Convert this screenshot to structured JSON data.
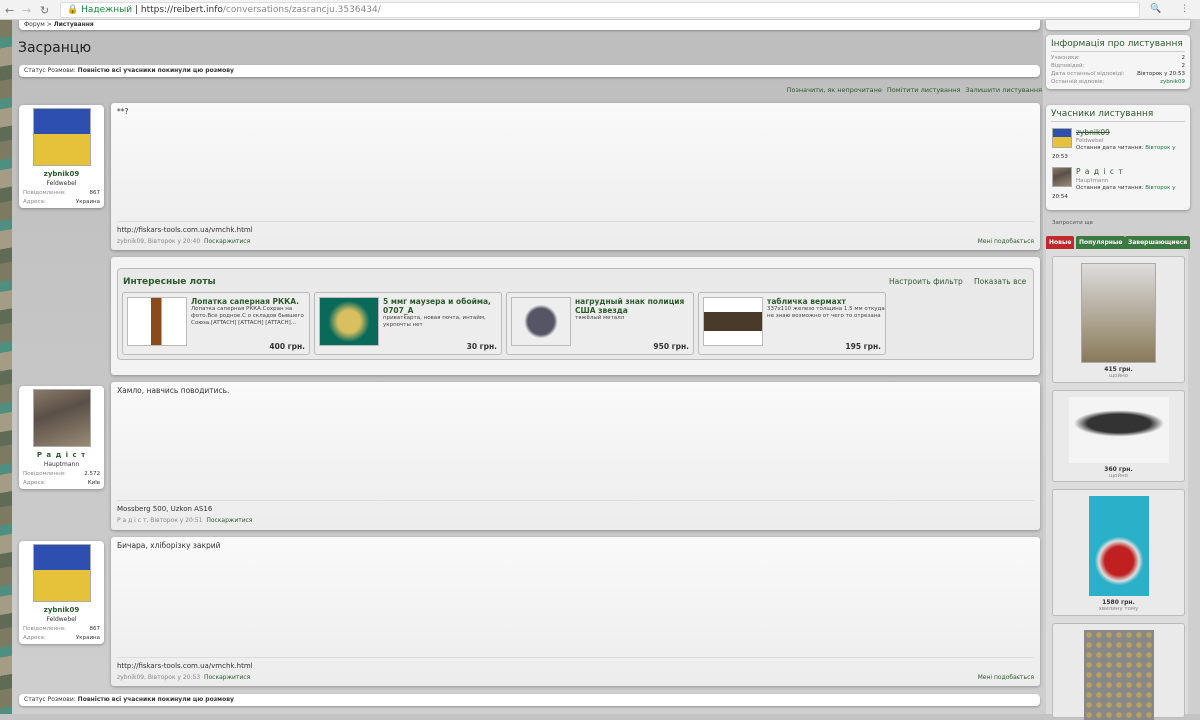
{
  "browser": {
    "secure_label": "Надежный",
    "url_host": "https://reibert.info",
    "url_path": "/conversations/zasrancju.3536434/"
  },
  "breadcrumb": {
    "home": "Форум",
    "sep": ">",
    "current": "Листування"
  },
  "page_title": "Засранцю",
  "status": {
    "label": "Статус Розмови:",
    "value": "Повністю всі учасники покинули цю розмову"
  },
  "actions": [
    "Позначити, як непрочитане",
    "Помітити листування",
    "Залишити листування"
  ],
  "user_labels": {
    "messages": "Повідомлення:",
    "address": "Адреса:"
  },
  "posts": [
    {
      "user": "zybnik09",
      "rank": "Feldwebel",
      "messages": "867",
      "address": "Украина",
      "text": "**?",
      "signature": "http://fiskars-tools.com.ua/vmchk.html",
      "meta": "zybnik09, Вівторок у 20:40",
      "report": "Поскаржитися",
      "like": "Мені подобається"
    },
    {
      "user": "Р а д і с т",
      "rank": "Hauptmann",
      "messages": "2.572",
      "address": "Київ",
      "text": "Хамло, навчись поводитись.",
      "signature": "Mossberg 500, Uzkon AS16",
      "meta": "Р а д і с т, Вівторок у 20:51",
      "report": "Поскаржитися"
    },
    {
      "user": "zybnik09",
      "rank": "Feldwebel",
      "messages": "867",
      "address": "Украина",
      "text": "Бичара, хліборізку закрий",
      "signature": "http://fiskars-tools.com.ua/vmchk.html",
      "meta": "zybnik09, Вівторок у 20:53",
      "report": "Поскаржитися",
      "like": "Мені подобається"
    }
  ],
  "lots": {
    "title": "Интересные лоты",
    "filter": "Настроить фильтр",
    "show_all": "Показать все",
    "items": [
      {
        "title": "Лопатка саперная РККА.",
        "desc": "Лопатка саперная РККА.Сохран на фото.Все родное.С о складов бывшего Союза.[ATTACH] [ATTACH] [ATTACH]...",
        "price": "400 грн."
      },
      {
        "title": "5 ммг маузера и обойма, 0707_A",
        "desc": "приватkарта, новая почта, интайм, укрпочты нет",
        "price": "30 грн."
      },
      {
        "title": "нагрудный знак полиция США звезда",
        "desc": "тяжёлый металл",
        "price": "950 грн."
      },
      {
        "title": "табличка вермахт",
        "desc": "337x110 железо толщина 1.5 мм откуда не знаю возможно от чего то отрезана",
        "price": "195 грн."
      }
    ]
  },
  "sidebar": {
    "info": {
      "title": "Інформація про листування",
      "rows": [
        {
          "k": "Учасники:",
          "v": "2"
        },
        {
          "k": "Відповідей:",
          "v": "2"
        },
        {
          "k": "Дата останньої відповіді:",
          "v": "Вівторок у 20:53"
        },
        {
          "k": "Останній відповів:",
          "v": "zybnik09"
        }
      ]
    },
    "participants": {
      "title": "Учасники листування",
      "read_label": "Остання дата читання:",
      "list": [
        {
          "name": "zybnik09",
          "rank": "Feldwebel",
          "date": "Вівторок у",
          "time": "20:53"
        },
        {
          "name": "Р а д і с т",
          "rank": "Hauptmann",
          "date": "Вівторок у",
          "time": "20:54"
        }
      ]
    },
    "invite": "Запросити ще",
    "tabs": [
      "Новые",
      "Популярные",
      "Завершающиеся"
    ],
    "items": [
      {
        "price": "415 грн.",
        "status": "щойно"
      },
      {
        "price": "360 грн.",
        "status": "щойно"
      },
      {
        "price": "1580 грн.",
        "status": "хвилину тому"
      }
    ]
  },
  "colors": {
    "accent": "#2d5a2d",
    "tab_new": "#c0282d",
    "tab_other": "#3a7a40"
  }
}
